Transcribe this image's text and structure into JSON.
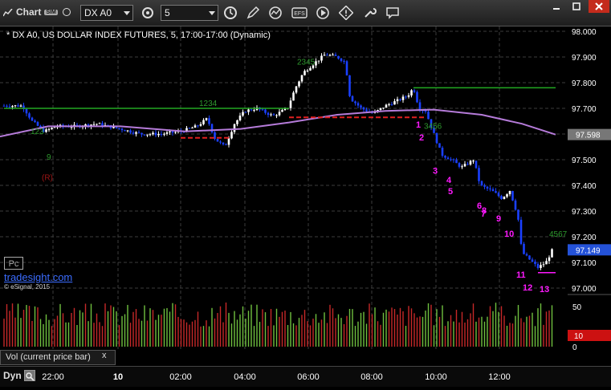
{
  "toolbar": {
    "title": "Chart",
    "sim_badge": "SIM",
    "symbol": "DX A0",
    "interval": "5"
  },
  "chart": {
    "info": "* DX A0, US DOLLAR INDEX FUTURES, 5, 17:00-17:00 (Dynamic)",
    "pc_label": "Pc",
    "brand": "tradesight.com",
    "copyright": "© eSignal, 2015",
    "annotation_r": "(R)",
    "last_price": "97.149",
    "ma_value": "97.598"
  },
  "volume": {
    "label": "Vol (current price bar)",
    "close": "x",
    "current_value": "10"
  },
  "bottom": {
    "label": "Dyn",
    "time_ticks": [
      "22:00",
      "10",
      "02:00",
      "04:00",
      "06:00",
      "08:00",
      "10:00",
      "12:00"
    ]
  },
  "colors": {
    "bull": "#ffffff",
    "bear": "#1a40ff",
    "ma": "#b57bd9",
    "green_line": "#22a822",
    "red_dash": "#e02020",
    "magenta": "#ff19ff",
    "price_tag": "#2452d8",
    "vol_tag": "#cc1111"
  },
  "chart_data": {
    "type": "candlestick",
    "y_axis_ticks": [
      "98.000",
      "97.900",
      "97.800",
      "97.700",
      "97.600",
      "97.500",
      "97.400",
      "97.300",
      "97.200",
      "97.100",
      "97.000"
    ],
    "ylim": [
      96.985,
      98.015
    ],
    "volume_axis_ticks": [
      "50",
      "0"
    ],
    "volume_ylim": [
      0,
      60
    ],
    "moving_average": 97.598,
    "last_price": 97.149,
    "levels": [
      {
        "color": "green",
        "value": 97.7,
        "x_start": "start",
        "x_end": "~05:45"
      },
      {
        "color": "green",
        "value": 97.78,
        "x_start": "~09:30",
        "x_end": "~13:00"
      },
      {
        "color": "red",
        "value": 97.585,
        "x_start": "~03:00",
        "x_end": "~03:50"
      },
      {
        "color": "red",
        "value": 97.665,
        "x_start": "~06:00",
        "x_end": "~09:30"
      }
    ],
    "sequential_counts_magenta": [
      "1",
      "2",
      "3",
      "4",
      "5",
      "6",
      "7",
      "8",
      "9",
      "10",
      "11",
      "12",
      "13"
    ],
    "sequential_counts_green": [
      "1",
      "2",
      "3",
      "4",
      "5",
      "6",
      "7",
      "8",
      "9"
    ]
  }
}
